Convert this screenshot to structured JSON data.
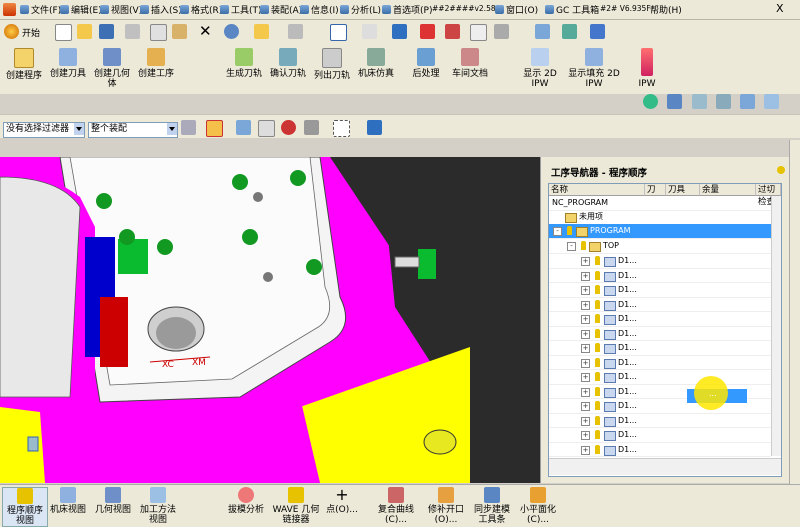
{
  "menu": {
    "items": [
      "文件(F)",
      "编辑(E)",
      "视图(V)",
      "插入(S)",
      "格式(R)",
      "工具(T)",
      "装配(A)",
      "信息(I)",
      "分析(L)",
      "首选项(P)",
      "窗口(O)",
      "GC 工具箱",
      "帮助(H)"
    ],
    "extra1": "##2####v2.58",
    "extra2": "#2# V6.935F",
    "close": "X"
  },
  "toolbar": {
    "start_label": "开始",
    "row1": [
      "创建程序",
      "创建刀具",
      "创建几何体",
      "创建工序"
    ],
    "row2": [
      "生成刀轨",
      "确认刀轨",
      "列出刀轨",
      "机床仿真"
    ],
    "row3": [
      "后处理",
      "车间文档"
    ],
    "row4": [
      "显示 2D IPW",
      "显示填充 2D IPW"
    ],
    "row5": [
      "IPW"
    ]
  },
  "filters": {
    "filter_value": "没有选择过滤器",
    "assembly_value": "整个装配"
  },
  "viewport": {
    "axis_x": "XC",
    "axis_m": "XM"
  },
  "navigator": {
    "title": "工序导航器 - 程序顺序",
    "columns": [
      "名称",
      "刀",
      "刀具",
      "余量",
      "过切检查"
    ],
    "root": "NC_PROGRAM",
    "unused": "未用项",
    "program": "PROGRAM",
    "top": "TOP",
    "ops": [
      "D1...",
      "D1...",
      "D1...",
      "D1...",
      "D1...",
      "D1...",
      "D1...",
      "D1...",
      "D1...",
      "D1...",
      "D1...",
      "D1...",
      "D1...",
      "D1..."
    ],
    "drag_label": "..."
  },
  "bottom": {
    "tabs": [
      "程序顺序视图",
      "机床视图",
      "几何视图",
      "加工方法视图"
    ],
    "tools": [
      "拔模分析",
      "WAVE 几何链接器",
      "点(O)...",
      "复合曲线(C)...",
      "修补开口(O)...",
      "同步建模工具条",
      "小平面化(C)..."
    ]
  },
  "colors": {
    "menubar": "#ece9d8",
    "magenta": "#ff00ff",
    "yellow": "#ffff00",
    "selection": "#3399ff"
  }
}
